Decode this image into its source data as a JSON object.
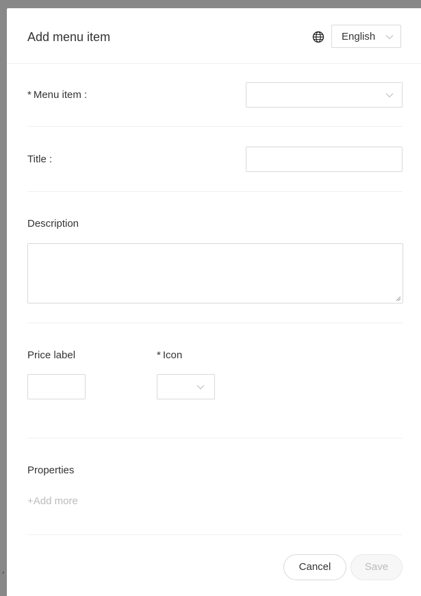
{
  "dialog": {
    "title": "Add menu item",
    "language": {
      "icon": "globe-icon",
      "selected": "English"
    }
  },
  "form": {
    "menu_item": {
      "required_mark": "*",
      "label": "Menu item :",
      "value": ""
    },
    "title": {
      "label": "Title :",
      "value": ""
    },
    "description": {
      "label": "Description",
      "value": ""
    },
    "price_label": {
      "label": "Price label",
      "value": ""
    },
    "icon": {
      "required_mark": "*",
      "label": "Icon",
      "value": ""
    },
    "properties": {
      "label": "Properties",
      "add_more": "+Add more"
    }
  },
  "footer": {
    "cancel_label": "Cancel",
    "save_label": "Save"
  },
  "colors": {
    "border": "#d9d9d9",
    "divider": "#f0f0f0",
    "muted_text": "#bbbbbb",
    "backdrop": "#888888"
  }
}
